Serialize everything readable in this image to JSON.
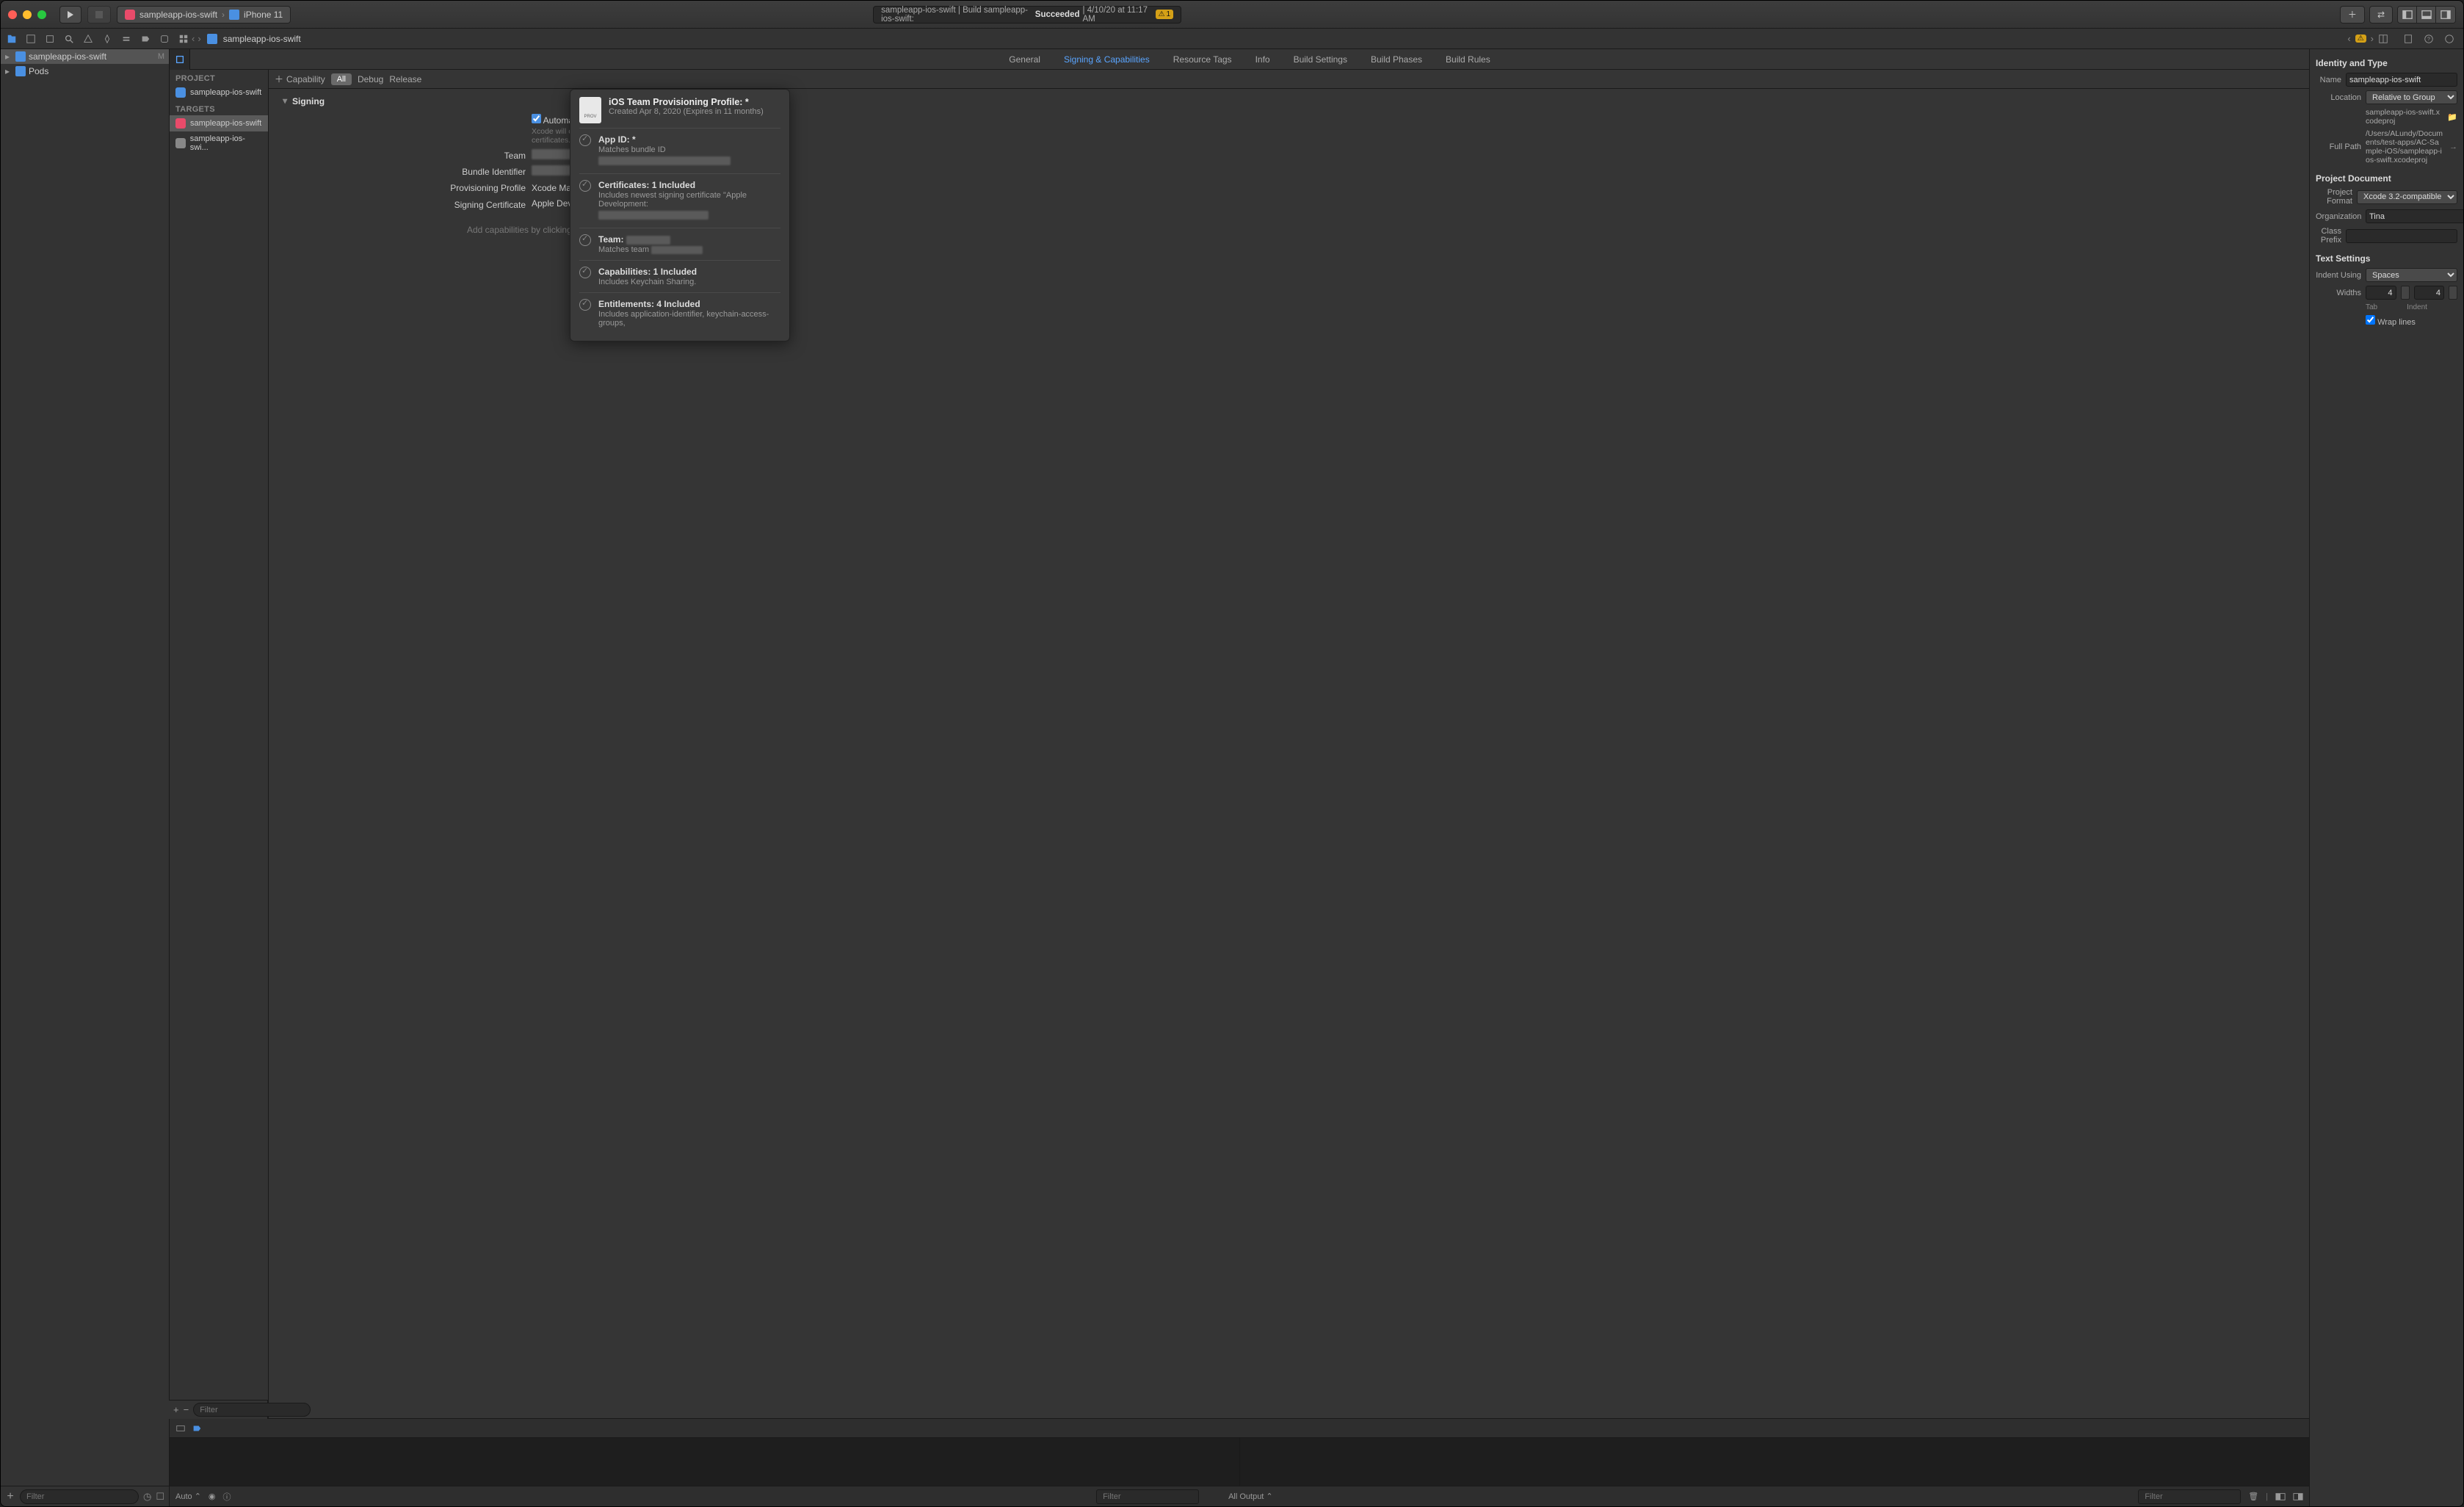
{
  "titlebar": {
    "scheme_target": "sampleapp-ios-swift",
    "scheme_device": "iPhone 11",
    "activity_prefix": "sampleapp-ios-swift | Build sampleapp-ios-swift:",
    "activity_status": "Succeeded",
    "activity_time": "| 4/10/20 at 11:17 AM",
    "warn_count": "1"
  },
  "nav": {
    "tree": {
      "root": "sampleapp-ios-swift",
      "root_badge": "M",
      "pods": "Pods"
    },
    "filter_placeholder": "Filter"
  },
  "jumpbar": {
    "item": "sampleapp-ios-swift"
  },
  "projectcol": {
    "project_hdr": "PROJECT",
    "project_item": "sampleapp-ios-swift",
    "targets_hdr": "TARGETS",
    "target1": "sampleapp-ios-swift",
    "target2": "sampleapp-ios-swi...",
    "filter_placeholder": "Filter"
  },
  "tabs": {
    "general": "General",
    "signing": "Signing & Capabilities",
    "resource": "Resource Tags",
    "info": "Info",
    "build_settings": "Build Settings",
    "build_phases": "Build Phases",
    "build_rules": "Build Rules"
  },
  "capbar": {
    "capability": "Capability",
    "all": "All",
    "debug": "Debug",
    "release": "Release"
  },
  "signing": {
    "header": "Signing",
    "auto_label": "Automatically manage sign",
    "auto_help1": "Xcode will create and updat",
    "auto_help2": "certificates.",
    "team_lbl": "Team",
    "bundle_lbl": "Bundle Identifier",
    "prov_lbl": "Provisioning Profile",
    "prov_val": "Xcode Managed Profile",
    "cert_lbl": "Signing Certificate",
    "cert_val": "Apple Development:",
    "addcap": "Add capabilities by clicking t"
  },
  "popover": {
    "title": "iOS Team Provisioning Profile: *",
    "subtitle": "Created Apr 8, 2020 (Expires in 11 months)",
    "rows": [
      {
        "title": "App ID: *",
        "detail": "Matches bundle ID"
      },
      {
        "title": "Certificates: 1 Included",
        "detail": "Includes newest signing certificate \"Apple Development:"
      },
      {
        "title": "Team:",
        "detail": "Matches team"
      },
      {
        "title": "Capabilities: 1 Included",
        "detail": "Includes Keychain Sharing."
      },
      {
        "title": "Entitlements: 4 Included",
        "detail": "Includes application-identifier, keychain-access-groups,"
      }
    ]
  },
  "inspector": {
    "identity_hdr": "Identity and Type",
    "name_lbl": "Name",
    "name_val": "sampleapp-ios-swift",
    "location_lbl": "Location",
    "location_val": "Relative to Group",
    "location_path": "sampleapp-ios-swift.xcodeproj",
    "fullpath_lbl": "Full Path",
    "fullpath_val": "/Users/ALundy/Documents/test-apps/AC-Sample-iOS/sampleapp-ios-swift.xcodeproj",
    "projdoc_hdr": "Project Document",
    "format_lbl": "Project Format",
    "format_val": "Xcode 3.2-compatible",
    "org_lbl": "Organization",
    "org_val": "Tina",
    "prefix_lbl": "Class Prefix",
    "prefix_val": "",
    "text_hdr": "Text Settings",
    "indent_using_lbl": "Indent Using",
    "indent_using_val": "Spaces",
    "widths_lbl": "Widths",
    "tab_val": "4",
    "tab_lbl": "Tab",
    "indent_val": "4",
    "indent_lbl": "Indent",
    "wrap_lbl": "Wrap lines"
  },
  "debug": {
    "auto": "Auto",
    "filter_placeholder": "Filter",
    "all_output": "All Output",
    "filter2_placeholder": "Filter"
  }
}
